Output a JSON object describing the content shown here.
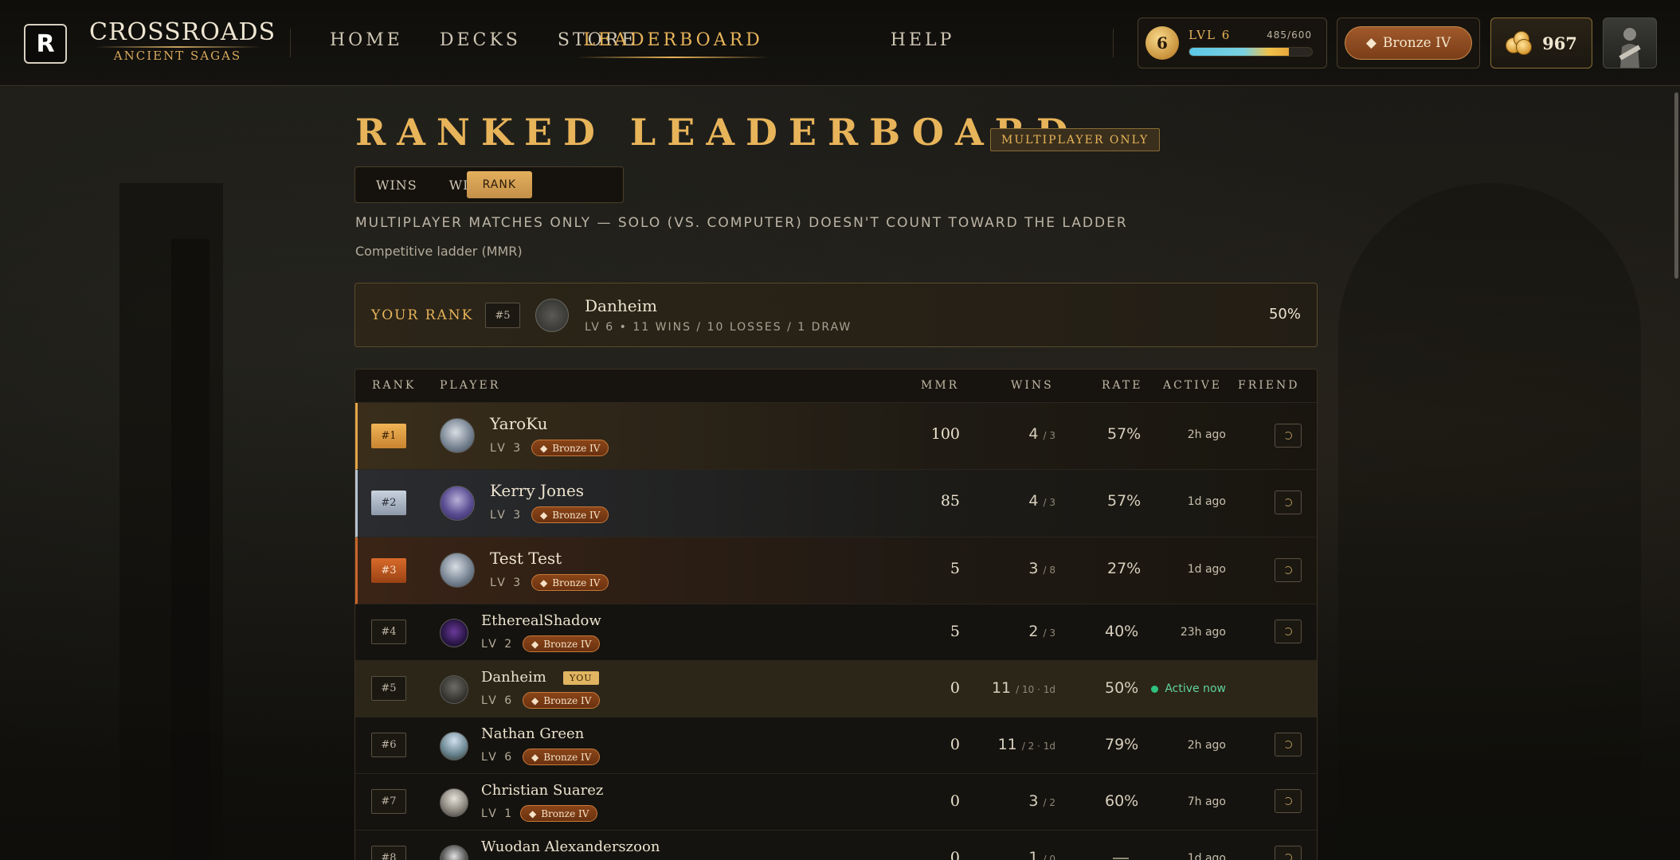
{
  "app": {
    "logo_letter": "R",
    "brand_title": "CROSSROADS",
    "brand_subtitle": "ANCIENT SAGAS"
  },
  "nav": {
    "items": [
      {
        "label": "HOME"
      },
      {
        "label": "DECKS"
      },
      {
        "label": "STORE"
      },
      {
        "label": "LEADERBOARD",
        "active": true
      },
      {
        "label": "HELP"
      }
    ]
  },
  "player_status": {
    "level_badge": "6",
    "level_label": "LVL 6",
    "xp_text": "485/600",
    "xp_progress": 0.81,
    "rank_label": "Bronze IV",
    "gold": "967"
  },
  "page": {
    "title": "RANKED LEADERBOARD",
    "badge": "MULTIPLAYER ONLY",
    "tabs": [
      {
        "label": "RANK",
        "active": true
      },
      {
        "label": "WINS"
      },
      {
        "label": "WIN RATE"
      }
    ],
    "note": "MULTIPLAYER MATCHES ONLY — SOLO (VS. COMPUTER) DOESN'T COUNT TOWARD THE LADDER",
    "subnote": "Competitive ladder (MMR)"
  },
  "your_rank": {
    "label": "YOUR RANK",
    "rank": "#5",
    "name": "Danheim",
    "stats": "LV 6 • 11 WINS / 10 LOSSES / 1 DRAW",
    "rate": "50%"
  },
  "table": {
    "headers": {
      "rank": "RANK",
      "player": "PLAYER",
      "mmr": "MMR",
      "wins": "WINS",
      "rate": "RATE",
      "active": "ACTIVE",
      "friend": "FRIEND"
    },
    "rows": [
      {
        "rank": "#1",
        "name": "YaroKu",
        "level": "LV 3",
        "tier": "Bronze IV",
        "mmr": "100",
        "wins": "4",
        "losses": "/ 3",
        "rate": "57%",
        "active": "2h ago"
      },
      {
        "rank": "#2",
        "name": "Kerry Jones",
        "level": "LV 3",
        "tier": "Bronze IV",
        "mmr": "85",
        "wins": "4",
        "losses": "/ 3",
        "rate": "57%",
        "active": "1d ago"
      },
      {
        "rank": "#3",
        "name": "Test Test",
        "level": "LV 3",
        "tier": "Bronze IV",
        "mmr": "5",
        "wins": "3",
        "losses": "/ 8",
        "rate": "27%",
        "active": "1d ago"
      },
      {
        "rank": "#4",
        "name": "EtherealShadow",
        "level": "LV 2",
        "tier": "Bronze IV",
        "mmr": "5",
        "wins": "2",
        "losses": "/ 3",
        "rate": "40%",
        "active": "23h ago"
      },
      {
        "rank": "#5",
        "name": "Danheim",
        "you_tag": "YOU",
        "level": "LV 6",
        "tier": "Bronze IV",
        "mmr": "0",
        "wins": "11",
        "losses": "/ 10 · 1d",
        "rate": "50%",
        "active": "Active now"
      },
      {
        "rank": "#6",
        "name": "Nathan Green",
        "level": "LV 6",
        "tier": "Bronze IV",
        "mmr": "0",
        "wins": "11",
        "losses": "/ 2 · 1d",
        "rate": "79%",
        "active": "2h ago"
      },
      {
        "rank": "#7",
        "name": "Christian Suarez",
        "level": "LV 1",
        "tier": "Bronze IV",
        "mmr": "0",
        "wins": "3",
        "losses": "/ 2",
        "rate": "60%",
        "active": "7h ago"
      },
      {
        "rank": "#8",
        "name": "Wuodan Alexanderszoon",
        "level": "",
        "tier": "",
        "mmr": "0",
        "wins": "1",
        "losses": "/ 0",
        "rate": "—",
        "active": "1d ago"
      }
    ]
  },
  "colors": {
    "accent_gold": "#e8b45a",
    "active_green": "#2ec27e",
    "bronze": "#8a4418"
  }
}
